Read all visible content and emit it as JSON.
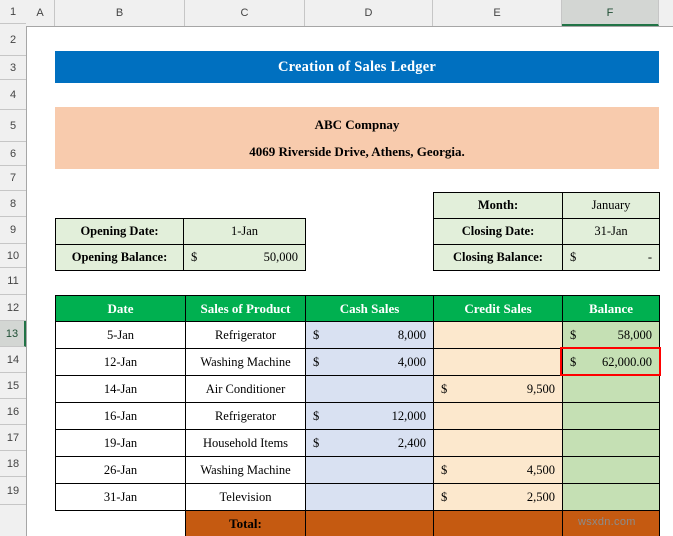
{
  "spreadsheet": {
    "column_headers": [
      "A",
      "B",
      "C",
      "D",
      "E",
      "F"
    ],
    "selected_column": "F",
    "row_headers": [
      "1",
      "2",
      "3",
      "4",
      "5",
      "6",
      "7",
      "8",
      "9",
      "10",
      "11",
      "12",
      "13",
      "14",
      "15",
      "16",
      "17",
      "18",
      "19"
    ],
    "selected_row": "13"
  },
  "title_banner": {
    "text": "Creation of Sales Ledger"
  },
  "company": {
    "name": "ABC Compnay",
    "address": "4069 Riverside Drive, Athens, Georgia."
  },
  "opening_info": {
    "rows": [
      {
        "label": "Opening Date:",
        "value": "1-Jan",
        "is_money": false
      },
      {
        "label": "Opening Balance:",
        "symbol": "$",
        "amount": "50,000",
        "is_money": true
      }
    ]
  },
  "closing_info": {
    "rows": [
      {
        "label": "Month:",
        "value": "January",
        "is_money": false
      },
      {
        "label": "Closing Date:",
        "value": "31-Jan",
        "is_money": false
      },
      {
        "label": "Closing Balance:",
        "symbol": "$",
        "amount": "-",
        "is_money": true
      }
    ]
  },
  "ledger": {
    "headers": [
      "Date",
      "Sales of Product",
      "Cash Sales",
      "Credit Sales",
      "Balance"
    ],
    "rows": [
      {
        "date": "5-Jan",
        "product": "Refrigerator",
        "cash_symbol": "$",
        "cash": "8,000",
        "credit_symbol": "",
        "credit": "",
        "bal_symbol": "$",
        "balance": "58,000"
      },
      {
        "date": "12-Jan",
        "product": "Washing Machine",
        "cash_symbol": "$",
        "cash": "4,000",
        "credit_symbol": "",
        "credit": "",
        "bal_symbol": "$",
        "balance": "62,000.00"
      },
      {
        "date": "14-Jan",
        "product": "Air Conditioner",
        "cash_symbol": "",
        "cash": "",
        "credit_symbol": "$",
        "credit": "9,500",
        "bal_symbol": "",
        "balance": ""
      },
      {
        "date": "16-Jan",
        "product": "Refrigerator",
        "cash_symbol": "$",
        "cash": "12,000",
        "credit_symbol": "",
        "credit": "",
        "bal_symbol": "",
        "balance": ""
      },
      {
        "date": "19-Jan",
        "product": "Household Items",
        "cash_symbol": "$",
        "cash": "2,400",
        "credit_symbol": "",
        "credit": "",
        "bal_symbol": "",
        "balance": ""
      },
      {
        "date": "26-Jan",
        "product": "Washing Machine",
        "cash_symbol": "",
        "cash": "",
        "credit_symbol": "$",
        "credit": "4,500",
        "bal_symbol": "",
        "balance": ""
      },
      {
        "date": "31-Jan",
        "product": "Television",
        "cash_symbol": "",
        "cash": "",
        "credit_symbol": "$",
        "credit": "2,500",
        "bal_symbol": "",
        "balance": ""
      }
    ],
    "total_label": "Total:"
  },
  "highlight": {
    "cell": "62,000.00",
    "color": "#ff0000"
  },
  "watermark": {
    "text": "wsxdn.com"
  },
  "colors": {
    "title_bg": "#0070c0",
    "company_bg": "#f8cbad",
    "info_bg": "#e2efda",
    "header_green": "#00b050",
    "cash_blue": "#d9e1f2",
    "credit_orange": "#fce8cd",
    "balance_green": "#c5e0b4",
    "total_orange": "#c55a11"
  }
}
